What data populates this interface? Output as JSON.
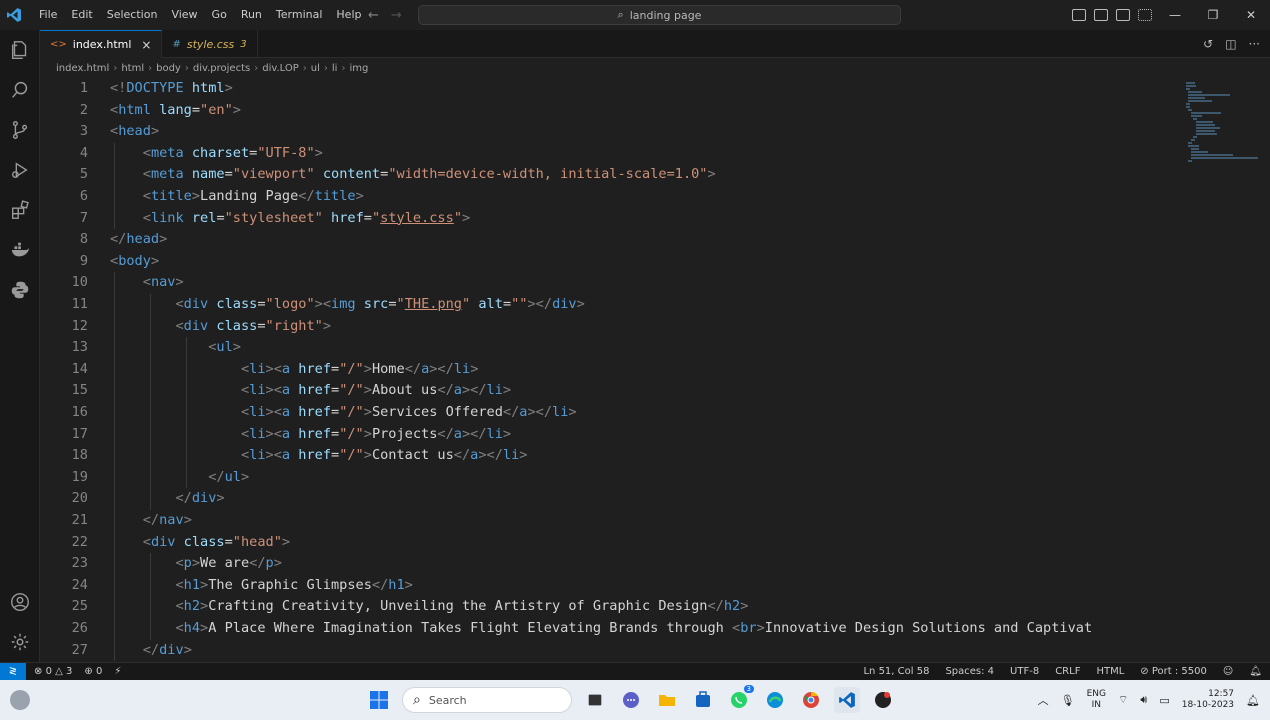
{
  "titlebar": {
    "menu": [
      "File",
      "Edit",
      "Selection",
      "View",
      "Go",
      "Run",
      "Terminal",
      "Help"
    ],
    "search_text": "landing page"
  },
  "tabs": [
    {
      "label": "index.html",
      "close": "×"
    },
    {
      "label": "style.css",
      "badge": "3"
    }
  ],
  "breadcrumbs": [
    "index.html",
    "html",
    "body",
    "div.projects",
    "div.LOP",
    "ul",
    "li",
    "img"
  ],
  "editor": {
    "line_numbers": [
      "1",
      "2",
      "3",
      "4",
      "5",
      "6",
      "7",
      "8",
      "9",
      "10",
      "11",
      "12",
      "13",
      "14",
      "15",
      "16",
      "17",
      "18",
      "19",
      "20",
      "21",
      "22",
      "23",
      "24",
      "25",
      "26",
      "27"
    ],
    "lines": [
      [
        {
          "t": "tg",
          "v": "<!"
        },
        {
          "t": "tn",
          "v": "DOCTYPE"
        },
        {
          "t": "an",
          "v": " html"
        },
        {
          "t": "tg",
          "v": ">"
        }
      ],
      [
        {
          "t": "tg",
          "v": "<"
        },
        {
          "t": "tn",
          "v": "html"
        },
        {
          "t": "an",
          "v": " lang"
        },
        {
          "t": "tx",
          "v": "="
        },
        {
          "t": "av",
          "v": "\"en\""
        },
        {
          "t": "tg",
          "v": ">"
        }
      ],
      [
        {
          "t": "tg",
          "v": "<"
        },
        {
          "t": "tn",
          "v": "head"
        },
        {
          "t": "tg",
          "v": ">"
        }
      ],
      [
        {
          "t": "tx",
          "v": "    "
        },
        {
          "t": "tg",
          "v": "<"
        },
        {
          "t": "tn",
          "v": "meta"
        },
        {
          "t": "an",
          "v": " charset"
        },
        {
          "t": "tx",
          "v": "="
        },
        {
          "t": "av",
          "v": "\"UTF-8\""
        },
        {
          "t": "tg",
          "v": ">"
        }
      ],
      [
        {
          "t": "tx",
          "v": "    "
        },
        {
          "t": "tg",
          "v": "<"
        },
        {
          "t": "tn",
          "v": "meta"
        },
        {
          "t": "an",
          "v": " name"
        },
        {
          "t": "tx",
          "v": "="
        },
        {
          "t": "av",
          "v": "\"viewport\""
        },
        {
          "t": "an",
          "v": " content"
        },
        {
          "t": "tx",
          "v": "="
        },
        {
          "t": "av",
          "v": "\"width=device-width, initial-scale=1.0\""
        },
        {
          "t": "tg",
          "v": ">"
        }
      ],
      [
        {
          "t": "tx",
          "v": "    "
        },
        {
          "t": "tg",
          "v": "<"
        },
        {
          "t": "tn",
          "v": "title"
        },
        {
          "t": "tg",
          "v": ">"
        },
        {
          "t": "tx",
          "v": "Landing Page"
        },
        {
          "t": "tg",
          "v": "</"
        },
        {
          "t": "tn",
          "v": "title"
        },
        {
          "t": "tg",
          "v": ">"
        }
      ],
      [
        {
          "t": "tx",
          "v": "    "
        },
        {
          "t": "tg",
          "v": "<"
        },
        {
          "t": "tn",
          "v": "link"
        },
        {
          "t": "an",
          "v": " rel"
        },
        {
          "t": "tx",
          "v": "="
        },
        {
          "t": "av",
          "v": "\"stylesheet\""
        },
        {
          "t": "an",
          "v": " href"
        },
        {
          "t": "tx",
          "v": "="
        },
        {
          "t": "av",
          "v": "\""
        },
        {
          "t": "av ul",
          "v": "style.css"
        },
        {
          "t": "av",
          "v": "\""
        },
        {
          "t": "tg",
          "v": ">"
        }
      ],
      [
        {
          "t": "tg",
          "v": "</"
        },
        {
          "t": "tn",
          "v": "head"
        },
        {
          "t": "tg",
          "v": ">"
        }
      ],
      [
        {
          "t": "tg",
          "v": "<"
        },
        {
          "t": "tn",
          "v": "body"
        },
        {
          "t": "tg",
          "v": ">"
        }
      ],
      [
        {
          "t": "tx",
          "v": "    "
        },
        {
          "t": "tg",
          "v": "<"
        },
        {
          "t": "tn",
          "v": "nav"
        },
        {
          "t": "tg",
          "v": ">"
        }
      ],
      [
        {
          "t": "tx",
          "v": "        "
        },
        {
          "t": "tg",
          "v": "<"
        },
        {
          "t": "tn",
          "v": "div"
        },
        {
          "t": "an",
          "v": " class"
        },
        {
          "t": "tx",
          "v": "="
        },
        {
          "t": "av",
          "v": "\"logo\""
        },
        {
          "t": "tg",
          "v": "><"
        },
        {
          "t": "tn",
          "v": "img"
        },
        {
          "t": "an",
          "v": " src"
        },
        {
          "t": "tx",
          "v": "="
        },
        {
          "t": "av",
          "v": "\""
        },
        {
          "t": "av ul",
          "v": "THE.png"
        },
        {
          "t": "av",
          "v": "\""
        },
        {
          "t": "an",
          "v": " alt"
        },
        {
          "t": "tx",
          "v": "="
        },
        {
          "t": "av",
          "v": "\"\""
        },
        {
          "t": "tg",
          "v": "></"
        },
        {
          "t": "tn",
          "v": "div"
        },
        {
          "t": "tg",
          "v": ">"
        }
      ],
      [
        {
          "t": "tx",
          "v": "        "
        },
        {
          "t": "tg",
          "v": "<"
        },
        {
          "t": "tn",
          "v": "div"
        },
        {
          "t": "an",
          "v": " class"
        },
        {
          "t": "tx",
          "v": "="
        },
        {
          "t": "av",
          "v": "\"right\""
        },
        {
          "t": "tg",
          "v": ">"
        }
      ],
      [
        {
          "t": "tx",
          "v": "            "
        },
        {
          "t": "tg",
          "v": "<"
        },
        {
          "t": "tn",
          "v": "ul"
        },
        {
          "t": "tg",
          "v": ">"
        }
      ],
      [
        {
          "t": "tx",
          "v": "                "
        },
        {
          "t": "tg",
          "v": "<"
        },
        {
          "t": "tn",
          "v": "li"
        },
        {
          "t": "tg",
          "v": "><"
        },
        {
          "t": "tn",
          "v": "a"
        },
        {
          "t": "an",
          "v": " href"
        },
        {
          "t": "tx",
          "v": "="
        },
        {
          "t": "av",
          "v": "\"/\""
        },
        {
          "t": "tg",
          "v": ">"
        },
        {
          "t": "tx",
          "v": "Home"
        },
        {
          "t": "tg",
          "v": "</"
        },
        {
          "t": "tn",
          "v": "a"
        },
        {
          "t": "tg",
          "v": "></"
        },
        {
          "t": "tn",
          "v": "li"
        },
        {
          "t": "tg",
          "v": ">"
        }
      ],
      [
        {
          "t": "tx",
          "v": "                "
        },
        {
          "t": "tg",
          "v": "<"
        },
        {
          "t": "tn",
          "v": "li"
        },
        {
          "t": "tg",
          "v": "><"
        },
        {
          "t": "tn",
          "v": "a"
        },
        {
          "t": "an",
          "v": " href"
        },
        {
          "t": "tx",
          "v": "="
        },
        {
          "t": "av",
          "v": "\"/\""
        },
        {
          "t": "tg",
          "v": ">"
        },
        {
          "t": "tx",
          "v": "About us"
        },
        {
          "t": "tg",
          "v": "</"
        },
        {
          "t": "tn",
          "v": "a"
        },
        {
          "t": "tg",
          "v": "></"
        },
        {
          "t": "tn",
          "v": "li"
        },
        {
          "t": "tg",
          "v": ">"
        }
      ],
      [
        {
          "t": "tx",
          "v": "                "
        },
        {
          "t": "tg",
          "v": "<"
        },
        {
          "t": "tn",
          "v": "li"
        },
        {
          "t": "tg",
          "v": "><"
        },
        {
          "t": "tn",
          "v": "a"
        },
        {
          "t": "an",
          "v": " href"
        },
        {
          "t": "tx",
          "v": "="
        },
        {
          "t": "av",
          "v": "\"/\""
        },
        {
          "t": "tg",
          "v": ">"
        },
        {
          "t": "tx",
          "v": "Services Offered"
        },
        {
          "t": "tg",
          "v": "</"
        },
        {
          "t": "tn",
          "v": "a"
        },
        {
          "t": "tg",
          "v": "></"
        },
        {
          "t": "tn",
          "v": "li"
        },
        {
          "t": "tg",
          "v": ">"
        }
      ],
      [
        {
          "t": "tx",
          "v": "                "
        },
        {
          "t": "tg",
          "v": "<"
        },
        {
          "t": "tn",
          "v": "li"
        },
        {
          "t": "tg",
          "v": "><"
        },
        {
          "t": "tn",
          "v": "a"
        },
        {
          "t": "an",
          "v": " href"
        },
        {
          "t": "tx",
          "v": "="
        },
        {
          "t": "av",
          "v": "\"/\""
        },
        {
          "t": "tg",
          "v": ">"
        },
        {
          "t": "tx",
          "v": "Projects"
        },
        {
          "t": "tg",
          "v": "</"
        },
        {
          "t": "tn",
          "v": "a"
        },
        {
          "t": "tg",
          "v": "></"
        },
        {
          "t": "tn",
          "v": "li"
        },
        {
          "t": "tg",
          "v": ">"
        }
      ],
      [
        {
          "t": "tx",
          "v": "                "
        },
        {
          "t": "tg",
          "v": "<"
        },
        {
          "t": "tn",
          "v": "li"
        },
        {
          "t": "tg",
          "v": "><"
        },
        {
          "t": "tn",
          "v": "a"
        },
        {
          "t": "an",
          "v": " href"
        },
        {
          "t": "tx",
          "v": "="
        },
        {
          "t": "av",
          "v": "\"/\""
        },
        {
          "t": "tg",
          "v": ">"
        },
        {
          "t": "tx",
          "v": "Contact us"
        },
        {
          "t": "tg",
          "v": "</"
        },
        {
          "t": "tn",
          "v": "a"
        },
        {
          "t": "tg",
          "v": "></"
        },
        {
          "t": "tn",
          "v": "li"
        },
        {
          "t": "tg",
          "v": ">"
        }
      ],
      [
        {
          "t": "tx",
          "v": "            "
        },
        {
          "t": "tg",
          "v": "</"
        },
        {
          "t": "tn",
          "v": "ul"
        },
        {
          "t": "tg",
          "v": ">"
        }
      ],
      [
        {
          "t": "tx",
          "v": "        "
        },
        {
          "t": "tg",
          "v": "</"
        },
        {
          "t": "tn",
          "v": "div"
        },
        {
          "t": "tg",
          "v": ">"
        }
      ],
      [
        {
          "t": "tx",
          "v": "    "
        },
        {
          "t": "tg",
          "v": "</"
        },
        {
          "t": "tn",
          "v": "nav"
        },
        {
          "t": "tg",
          "v": ">"
        }
      ],
      [
        {
          "t": "tx",
          "v": "    "
        },
        {
          "t": "tg",
          "v": "<"
        },
        {
          "t": "tn",
          "v": "div"
        },
        {
          "t": "an",
          "v": " class"
        },
        {
          "t": "tx",
          "v": "="
        },
        {
          "t": "av",
          "v": "\"head\""
        },
        {
          "t": "tg",
          "v": ">"
        }
      ],
      [
        {
          "t": "tx",
          "v": "        "
        },
        {
          "t": "tg",
          "v": "<"
        },
        {
          "t": "tn",
          "v": "p"
        },
        {
          "t": "tg",
          "v": ">"
        },
        {
          "t": "tx",
          "v": "We are"
        },
        {
          "t": "tg",
          "v": "</"
        },
        {
          "t": "tn",
          "v": "p"
        },
        {
          "t": "tg",
          "v": ">"
        }
      ],
      [
        {
          "t": "tx",
          "v": "        "
        },
        {
          "t": "tg",
          "v": "<"
        },
        {
          "t": "tn",
          "v": "h1"
        },
        {
          "t": "tg",
          "v": ">"
        },
        {
          "t": "tx",
          "v": "The Graphic Glimpses"
        },
        {
          "t": "tg",
          "v": "</"
        },
        {
          "t": "tn",
          "v": "h1"
        },
        {
          "t": "tg",
          "v": ">"
        }
      ],
      [
        {
          "t": "tx",
          "v": "        "
        },
        {
          "t": "tg",
          "v": "<"
        },
        {
          "t": "tn",
          "v": "h2"
        },
        {
          "t": "tg",
          "v": ">"
        },
        {
          "t": "tx",
          "v": "Crafting Creativity, Unveiling the Artistry of Graphic Design"
        },
        {
          "t": "tg",
          "v": "</"
        },
        {
          "t": "tn",
          "v": "h2"
        },
        {
          "t": "tg",
          "v": ">"
        }
      ],
      [
        {
          "t": "tx",
          "v": "        "
        },
        {
          "t": "tg",
          "v": "<"
        },
        {
          "t": "tn",
          "v": "h4"
        },
        {
          "t": "tg",
          "v": ">"
        },
        {
          "t": "tx",
          "v": "A Place Where Imagination Takes Flight Elevating Brands through "
        },
        {
          "t": "tg",
          "v": "<"
        },
        {
          "t": "tn",
          "v": "br"
        },
        {
          "t": "tg",
          "v": ">"
        },
        {
          "t": "tx",
          "v": "Innovative Design Solutions and Captivat"
        }
      ],
      [
        {
          "t": "tx",
          "v": "    "
        },
        {
          "t": "tg",
          "v": "</"
        },
        {
          "t": "tn",
          "v": "div"
        },
        {
          "t": "tg",
          "v": ">"
        }
      ]
    ]
  },
  "statusbar": {
    "errors": "0",
    "warnings": "3",
    "ports": "0",
    "position": "Ln 51, Col 58",
    "spaces": "Spaces: 4",
    "encoding": "UTF-8",
    "eol": "CRLF",
    "language": "HTML",
    "port": "Port : 5500"
  },
  "taskbar": {
    "search_label": "Search",
    "whatsapp_badge": "3",
    "lang_top": "ENG",
    "lang_bottom": "IN",
    "time": "12:57",
    "date": "18-10-2023"
  },
  "colors": {
    "accent": "#0078d4",
    "tag": "#569cd6",
    "attr": "#9cdcfe",
    "string": "#ce9178"
  }
}
